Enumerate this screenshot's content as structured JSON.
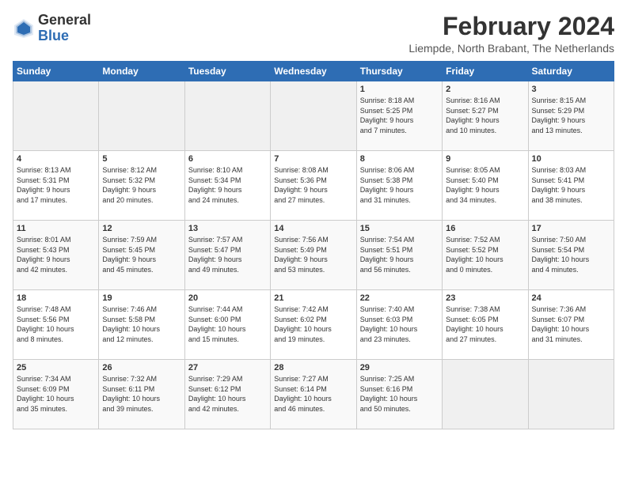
{
  "logo": {
    "line1": "General",
    "line2": "Blue"
  },
  "title": "February 2024",
  "subtitle": "Liempde, North Brabant, The Netherlands",
  "weekdays": [
    "Sunday",
    "Monday",
    "Tuesday",
    "Wednesday",
    "Thursday",
    "Friday",
    "Saturday"
  ],
  "weeks": [
    [
      {
        "day": "",
        "info": ""
      },
      {
        "day": "",
        "info": ""
      },
      {
        "day": "",
        "info": ""
      },
      {
        "day": "",
        "info": ""
      },
      {
        "day": "1",
        "info": "Sunrise: 8:18 AM\nSunset: 5:25 PM\nDaylight: 9 hours\nand 7 minutes."
      },
      {
        "day": "2",
        "info": "Sunrise: 8:16 AM\nSunset: 5:27 PM\nDaylight: 9 hours\nand 10 minutes."
      },
      {
        "day": "3",
        "info": "Sunrise: 8:15 AM\nSunset: 5:29 PM\nDaylight: 9 hours\nand 13 minutes."
      }
    ],
    [
      {
        "day": "4",
        "info": "Sunrise: 8:13 AM\nSunset: 5:31 PM\nDaylight: 9 hours\nand 17 minutes."
      },
      {
        "day": "5",
        "info": "Sunrise: 8:12 AM\nSunset: 5:32 PM\nDaylight: 9 hours\nand 20 minutes."
      },
      {
        "day": "6",
        "info": "Sunrise: 8:10 AM\nSunset: 5:34 PM\nDaylight: 9 hours\nand 24 minutes."
      },
      {
        "day": "7",
        "info": "Sunrise: 8:08 AM\nSunset: 5:36 PM\nDaylight: 9 hours\nand 27 minutes."
      },
      {
        "day": "8",
        "info": "Sunrise: 8:06 AM\nSunset: 5:38 PM\nDaylight: 9 hours\nand 31 minutes."
      },
      {
        "day": "9",
        "info": "Sunrise: 8:05 AM\nSunset: 5:40 PM\nDaylight: 9 hours\nand 34 minutes."
      },
      {
        "day": "10",
        "info": "Sunrise: 8:03 AM\nSunset: 5:41 PM\nDaylight: 9 hours\nand 38 minutes."
      }
    ],
    [
      {
        "day": "11",
        "info": "Sunrise: 8:01 AM\nSunset: 5:43 PM\nDaylight: 9 hours\nand 42 minutes."
      },
      {
        "day": "12",
        "info": "Sunrise: 7:59 AM\nSunset: 5:45 PM\nDaylight: 9 hours\nand 45 minutes."
      },
      {
        "day": "13",
        "info": "Sunrise: 7:57 AM\nSunset: 5:47 PM\nDaylight: 9 hours\nand 49 minutes."
      },
      {
        "day": "14",
        "info": "Sunrise: 7:56 AM\nSunset: 5:49 PM\nDaylight: 9 hours\nand 53 minutes."
      },
      {
        "day": "15",
        "info": "Sunrise: 7:54 AM\nSunset: 5:51 PM\nDaylight: 9 hours\nand 56 minutes."
      },
      {
        "day": "16",
        "info": "Sunrise: 7:52 AM\nSunset: 5:52 PM\nDaylight: 10 hours\nand 0 minutes."
      },
      {
        "day": "17",
        "info": "Sunrise: 7:50 AM\nSunset: 5:54 PM\nDaylight: 10 hours\nand 4 minutes."
      }
    ],
    [
      {
        "day": "18",
        "info": "Sunrise: 7:48 AM\nSunset: 5:56 PM\nDaylight: 10 hours\nand 8 minutes."
      },
      {
        "day": "19",
        "info": "Sunrise: 7:46 AM\nSunset: 5:58 PM\nDaylight: 10 hours\nand 12 minutes."
      },
      {
        "day": "20",
        "info": "Sunrise: 7:44 AM\nSunset: 6:00 PM\nDaylight: 10 hours\nand 15 minutes."
      },
      {
        "day": "21",
        "info": "Sunrise: 7:42 AM\nSunset: 6:02 PM\nDaylight: 10 hours\nand 19 minutes."
      },
      {
        "day": "22",
        "info": "Sunrise: 7:40 AM\nSunset: 6:03 PM\nDaylight: 10 hours\nand 23 minutes."
      },
      {
        "day": "23",
        "info": "Sunrise: 7:38 AM\nSunset: 6:05 PM\nDaylight: 10 hours\nand 27 minutes."
      },
      {
        "day": "24",
        "info": "Sunrise: 7:36 AM\nSunset: 6:07 PM\nDaylight: 10 hours\nand 31 minutes."
      }
    ],
    [
      {
        "day": "25",
        "info": "Sunrise: 7:34 AM\nSunset: 6:09 PM\nDaylight: 10 hours\nand 35 minutes."
      },
      {
        "day": "26",
        "info": "Sunrise: 7:32 AM\nSunset: 6:11 PM\nDaylight: 10 hours\nand 39 minutes."
      },
      {
        "day": "27",
        "info": "Sunrise: 7:29 AM\nSunset: 6:12 PM\nDaylight: 10 hours\nand 42 minutes."
      },
      {
        "day": "28",
        "info": "Sunrise: 7:27 AM\nSunset: 6:14 PM\nDaylight: 10 hours\nand 46 minutes."
      },
      {
        "day": "29",
        "info": "Sunrise: 7:25 AM\nSunset: 6:16 PM\nDaylight: 10 hours\nand 50 minutes."
      },
      {
        "day": "",
        "info": ""
      },
      {
        "day": "",
        "info": ""
      }
    ]
  ]
}
